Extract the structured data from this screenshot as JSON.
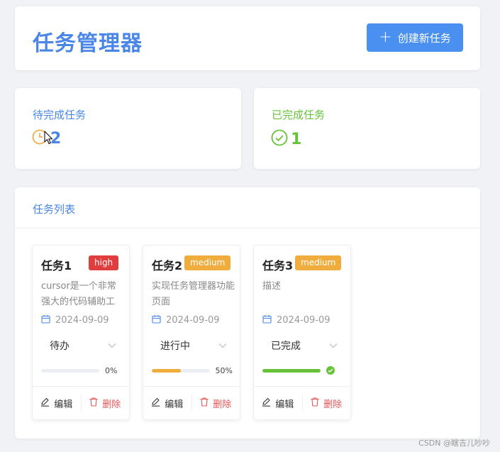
{
  "header": {
    "title": "任务管理器",
    "create_button": "创建新任务"
  },
  "stats": {
    "pending": {
      "label": "待完成任务",
      "value": "2",
      "color": "#4a86e8",
      "icon_color": "#f0ad4e"
    },
    "completed": {
      "label": "已完成任务",
      "value": "1",
      "color": "#67c23a"
    }
  },
  "task_list": {
    "title": "任务列表",
    "tasks": [
      {
        "title": "任务1",
        "priority": "high",
        "priority_color": "#e03e3e",
        "description": "cursor是一个非常强大的代码辅助工",
        "date": "2024-09-09",
        "status": "待办",
        "progress": 0,
        "progress_text": "0%",
        "progress_color": "#f0ad4e",
        "edit_label": "编辑",
        "delete_label": "删除"
      },
      {
        "title": "任务2",
        "priority": "medium",
        "priority_color": "#f0ad3e",
        "description": "实现任务管理器功能页面",
        "date": "2024-09-09",
        "status": "进行中",
        "progress": 50,
        "progress_text": "50%",
        "progress_color": "#f0ad3e",
        "edit_label": "编辑",
        "delete_label": "删除"
      },
      {
        "title": "任务3",
        "priority": "medium",
        "priority_color": "#f0ad3e",
        "description": "描述",
        "date": "2024-09-09",
        "status": "已完成",
        "progress": 100,
        "progress_text": "",
        "progress_color": "#67c23a",
        "edit_label": "编辑",
        "delete_label": "删除"
      }
    ]
  },
  "watermark": "CSDN @瞎吉儿吵吵",
  "accent_color": "#4a90f0"
}
